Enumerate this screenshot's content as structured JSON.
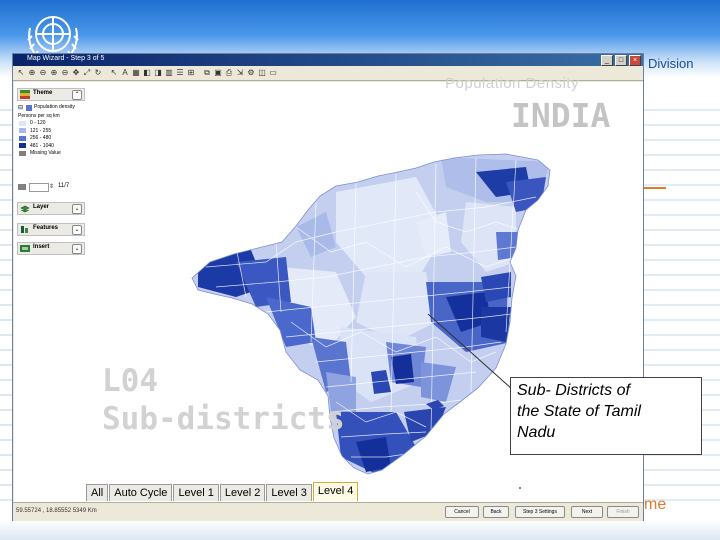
{
  "window": {
    "title": "Map Wizard - Step 3 of 5"
  },
  "header": {
    "division_text": "Division"
  },
  "footer": {
    "word": "me"
  },
  "overlay": {
    "watermark_line1": "Population Density",
    "watermark_line2": "INDIA",
    "level_label_line1": "L04",
    "level_label_line2": "Sub-districts",
    "callout_lines": [
      "Sub- Districts of",
      "the State of Tamil",
      "Nadu"
    ]
  },
  "panel": {
    "theme_label": "Theme",
    "layer_label": "Layer",
    "features_label": "Features",
    "insert_label": "Insert",
    "indicator": "Population density",
    "subtitle": "Persons per sq km",
    "legend": [
      {
        "label": "0 - 120",
        "color": "#dfe6f6"
      },
      {
        "label": "121 - 255",
        "color": "#aab9e8"
      },
      {
        "label": "256 - 480",
        "color": "#5a73d0"
      },
      {
        "label": "481 - 1040",
        "color": "#142f9a"
      },
      {
        "label": "Missing Value",
        "color": "#808080"
      }
    ],
    "class_count": "11/7"
  },
  "tabs": [
    "All",
    "Auto Cycle",
    "Level 1",
    "Level 2",
    "Level 3",
    "Level 4"
  ],
  "active_tab": "Level 4",
  "status": {
    "coords": "59.55724 , 18.85552 5349 Km",
    "cancel": "Cancel",
    "back": "Back",
    "step": "Step 3 Settings",
    "next": "Next",
    "finish": "Finish"
  },
  "colors": {
    "accent": "#1f6fd0",
    "orange": "#e07b28",
    "map_dark": "#142f9a",
    "map_light": "#dfe6f6"
  },
  "icons": [
    "un-emblem-icon",
    "arrow-icon",
    "zoom-in-icon",
    "zoom-out-icon",
    "pan-icon",
    "refresh-icon",
    "close-icon",
    "minimize-icon",
    "maximize-icon"
  ]
}
